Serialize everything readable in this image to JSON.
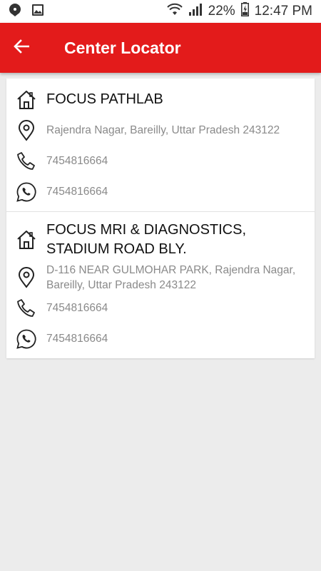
{
  "status_bar": {
    "battery": "22%",
    "time": "12:47 PM"
  },
  "app_bar": {
    "title": "Center Locator"
  },
  "centers": [
    {
      "name": "FOCUS PATHLAB",
      "address": "Rajendra Nagar, Bareilly, Uttar Pradesh 243122",
      "phone": "7454816664",
      "whatsapp": "7454816664"
    },
    {
      "name": "FOCUS MRI & DIAGNOSTICS, STADIUM ROAD BLY.",
      "address": "D-116 NEAR GULMOHAR PARK, Rajendra Nagar, Bareilly, Uttar Pradesh 243122",
      "phone": "7454816664",
      "whatsapp": "7454816664"
    }
  ]
}
